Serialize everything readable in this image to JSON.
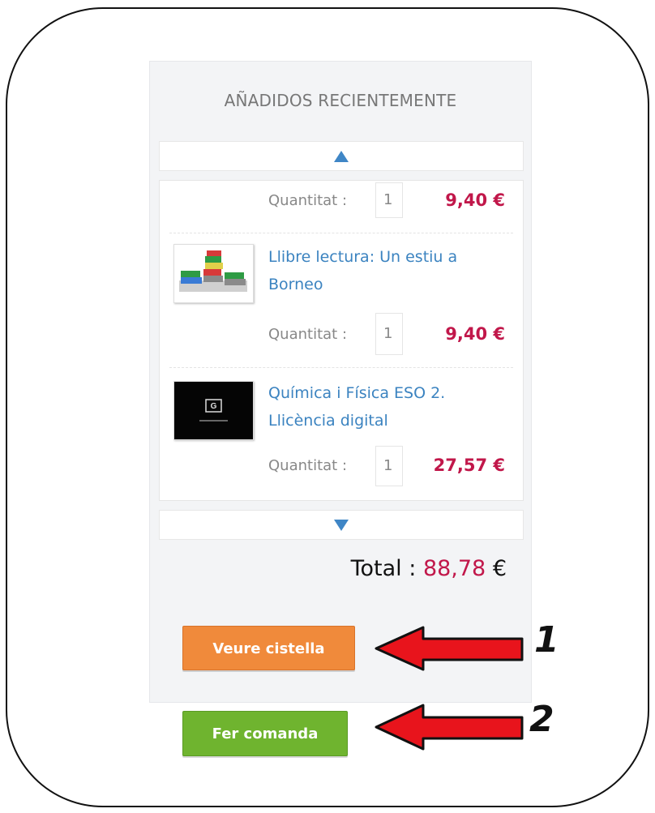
{
  "cart": {
    "title": "AÑADIDOS RECIENTEMENTE",
    "items": [
      {
        "name": "",
        "quantity_label": "Quantitat :",
        "quantity": "1",
        "price": "9,40 €"
      },
      {
        "name_line1": "Llibre lectura: Un estiu a",
        "name_line2": "Borneo",
        "quantity_label": "Quantitat :",
        "quantity": "1",
        "price": "9,40 €",
        "thumb_icon": "books-stack-icon"
      },
      {
        "name_line1": "Química i Física ESO 2.",
        "name_line2": "Llicència digital",
        "quantity_label": "Quantitat :",
        "quantity": "1",
        "price": "27,57 €",
        "thumb_icon": "digital-license-icon"
      }
    ],
    "total_label": "Total : ",
    "total_amount": "88,78",
    "total_currency": " €",
    "view_cart_label": "Veure cistella",
    "checkout_label": "Fer comanda"
  },
  "annotations": {
    "step1": "1",
    "step2": "2"
  },
  "colors": {
    "link": "#3b83c0",
    "price": "#c1174a",
    "orange": "#f08a3b",
    "green": "#6fb42f",
    "arrow": "#e8141c"
  }
}
